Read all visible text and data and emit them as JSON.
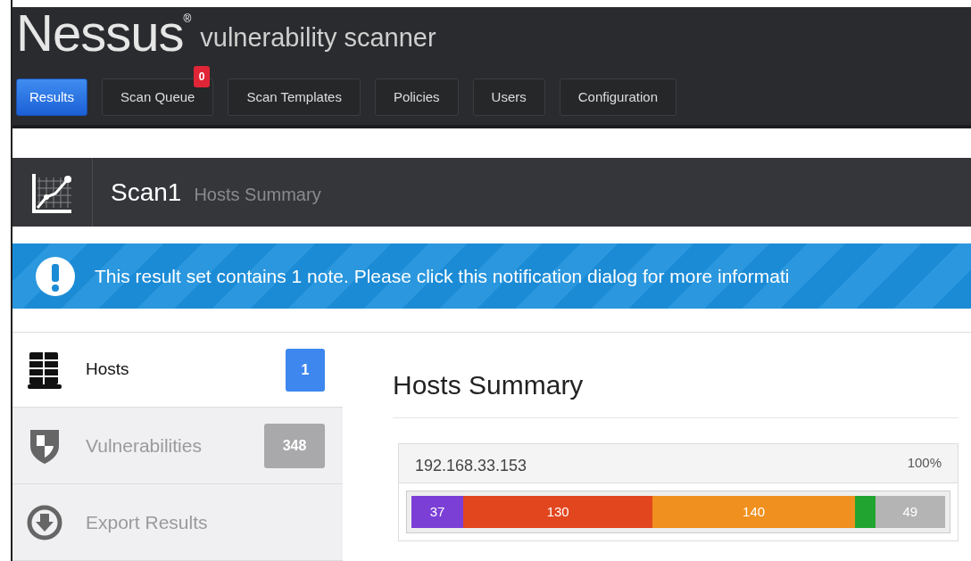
{
  "header": {
    "logo": "Nessus",
    "registered": "®",
    "tagline": "vulnerability scanner"
  },
  "nav": [
    {
      "label": "Results",
      "selected": true
    },
    {
      "label": "Scan Queue",
      "selected": false,
      "badge": "0"
    },
    {
      "label": "Scan Templates",
      "selected": false
    },
    {
      "label": "Policies",
      "selected": false
    },
    {
      "label": "Users",
      "selected": false
    },
    {
      "label": "Configuration",
      "selected": false
    }
  ],
  "scan": {
    "title": "Scan1",
    "subtitle": "Hosts Summary"
  },
  "notification": "This result set contains 1 note. Please click this notification dialog for more informati",
  "sidebar": {
    "items": [
      {
        "kind": "hosts",
        "label": "Hosts",
        "count": "1",
        "selected": true
      },
      {
        "kind": "vulnerabilities",
        "label": "Vulnerabilities",
        "count": "348",
        "selected": false
      },
      {
        "kind": "export",
        "label": "Export Results",
        "selected": false
      }
    ]
  },
  "main": {
    "heading": "Hosts Summary",
    "host": {
      "address": "192.168.33.153",
      "progress": "100%",
      "segments": [
        {
          "label": "37",
          "color": "#7b3fd6"
        },
        {
          "label": "130",
          "color": "#e2461f"
        },
        {
          "label": "140",
          "color": "#f0901e"
        },
        {
          "color": "#22a530"
        },
        {
          "label": "49",
          "color": "#b4b4b4"
        }
      ]
    }
  }
}
